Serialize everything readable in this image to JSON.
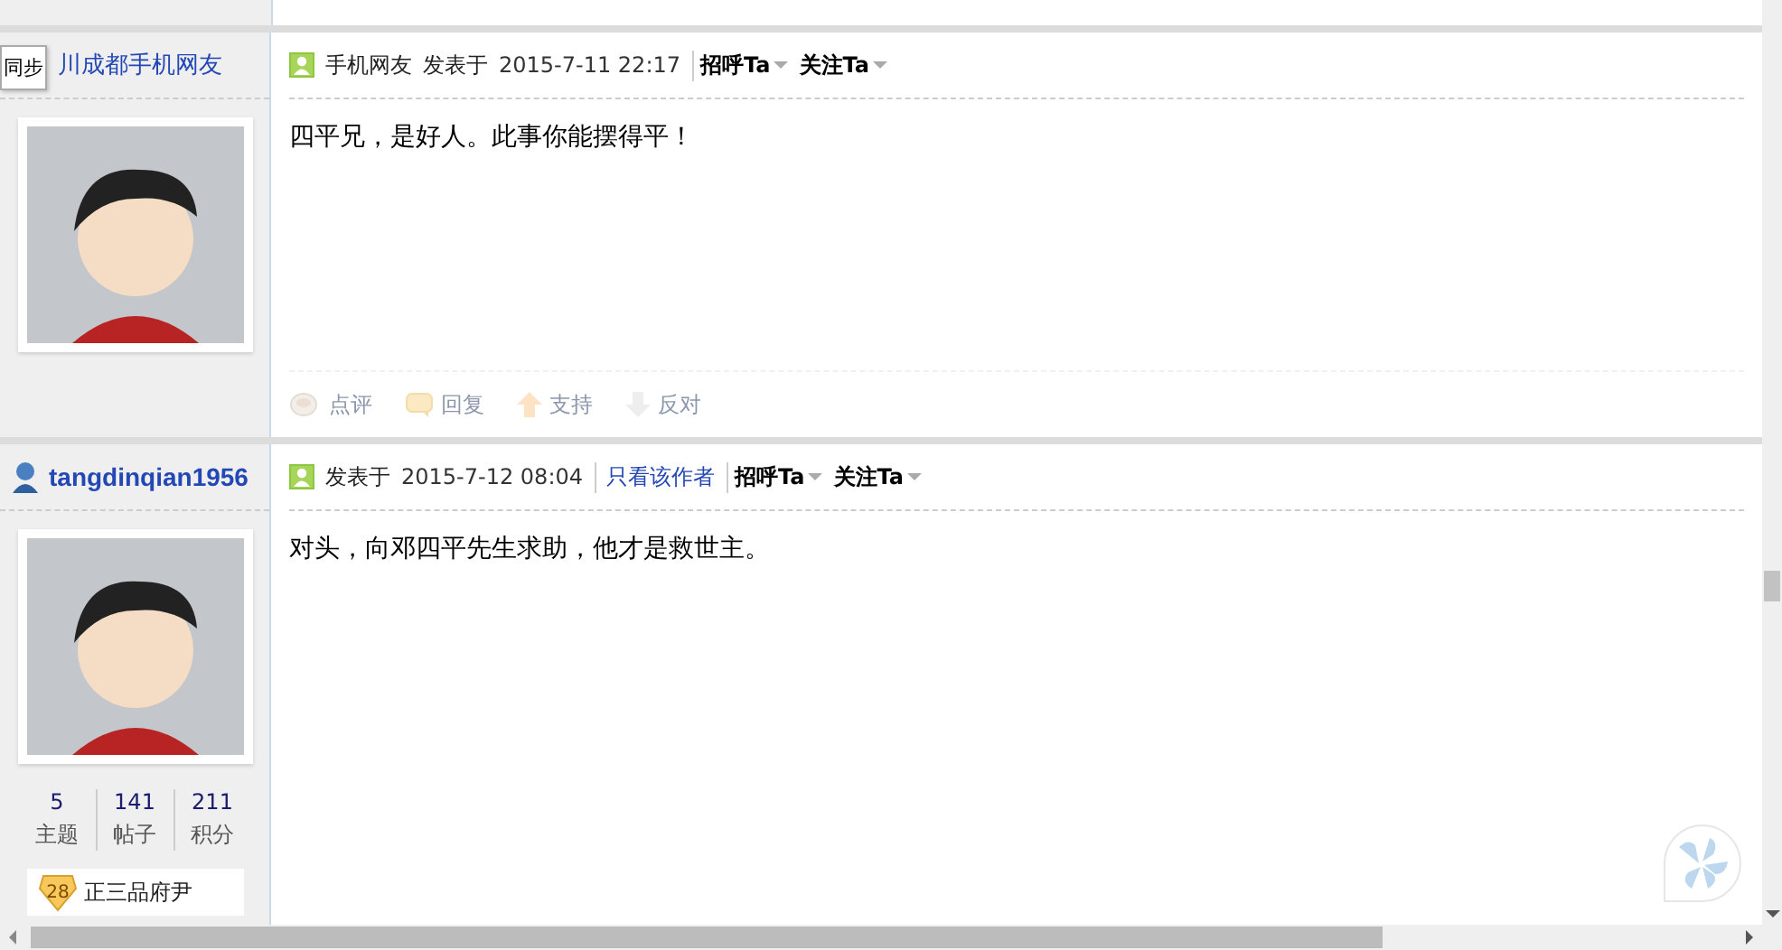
{
  "posts": [
    {
      "author": "川成都手机网友",
      "kind": "mobile",
      "tooltip": "同步",
      "meta": [
        {
          "kind": "source",
          "text": "手机网友"
        },
        {
          "kind": "label",
          "text": "发表于"
        },
        {
          "kind": "time",
          "text": "2015-7-11 22:17"
        },
        {
          "kind": "menu",
          "text": "招呼Ta"
        },
        {
          "kind": "menu",
          "text": "关注Ta"
        }
      ],
      "body": "四平兄，是好人。此事你能摆得平！",
      "actions": [
        {
          "kind": "comment",
          "text": "点评"
        },
        {
          "kind": "reply",
          "text": "回复"
        },
        {
          "kind": "support",
          "text": "支持"
        },
        {
          "kind": "oppose",
          "text": "反对"
        }
      ]
    },
    {
      "author": "tangdinqian1956",
      "kind": "member",
      "meta": [
        {
          "kind": "label",
          "text": "发表于"
        },
        {
          "kind": "time",
          "text": "2015-7-12 08:04"
        },
        {
          "kind": "link",
          "text": "只看该作者"
        },
        {
          "kind": "menu",
          "text": "招呼Ta"
        },
        {
          "kind": "menu",
          "text": "关注Ta"
        }
      ],
      "body": "对头，向邓四平先生求助，他才是救世主。",
      "stats": [
        {
          "value": "5",
          "label": "主题"
        },
        {
          "value": "141",
          "label": "帖子"
        },
        {
          "value": "211",
          "label": "积分"
        }
      ],
      "medal": {
        "level": "28",
        "title": "正三品府尹"
      }
    }
  ]
}
